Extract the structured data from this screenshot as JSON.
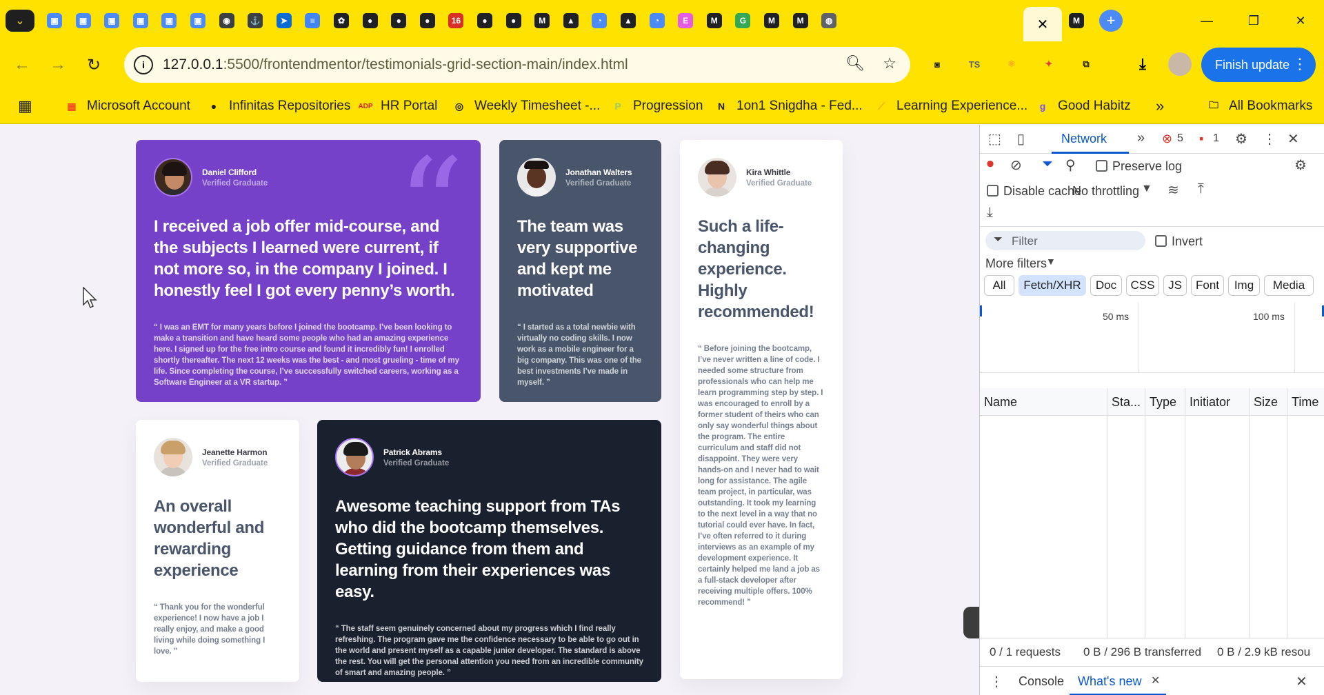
{
  "tabs": {
    "items": [
      {
        "icon": "monitor-favicon-icon",
        "color": "#4c8bf5",
        "glyph": "▣"
      },
      {
        "icon": "monitor-favicon-icon",
        "color": "#4c8bf5",
        "glyph": "▣"
      },
      {
        "icon": "monitor-favicon-icon",
        "color": "#4c8bf5",
        "glyph": "▣"
      },
      {
        "icon": "monitor-favicon-icon",
        "color": "#4c8bf5",
        "glyph": "▣"
      },
      {
        "icon": "monitor-favicon-icon",
        "color": "#4c8bf5",
        "glyph": "▣"
      },
      {
        "icon": "monitor-favicon-icon",
        "color": "#4c8bf5",
        "glyph": "▣"
      },
      {
        "icon": "compass-favicon-icon",
        "color": "#3c4043",
        "glyph": "◉"
      },
      {
        "icon": "anchor-favicon-icon",
        "color": "#3c4043",
        "glyph": "⚓"
      },
      {
        "icon": "azure-favicon-icon",
        "color": "#0a6cd4",
        "glyph": "➤"
      },
      {
        "icon": "docs-favicon-icon",
        "color": "#4285f4",
        "glyph": "≡"
      },
      {
        "icon": "openai-favicon-icon",
        "color": "#202124",
        "glyph": "✿"
      },
      {
        "icon": "github-favicon-icon",
        "color": "#202124",
        "glyph": "●"
      },
      {
        "icon": "github-favicon-icon",
        "color": "#202124",
        "glyph": "●"
      },
      {
        "icon": "github-favicon-icon",
        "color": "#202124",
        "glyph": "●"
      },
      {
        "icon": "calendar-favicon-icon",
        "color": "#d93025",
        "glyph": "16"
      },
      {
        "icon": "github-favicon-icon",
        "color": "#202124",
        "glyph": "●"
      },
      {
        "icon": "github-favicon-icon",
        "color": "#202124",
        "glyph": "●"
      },
      {
        "icon": "medium-favicon-icon",
        "color": "#202124",
        "glyph": "M"
      },
      {
        "icon": "triangle-favicon-icon",
        "color": "#202124",
        "glyph": "▲"
      },
      {
        "icon": "chat-favicon-icon",
        "color": "#4c8bf5",
        "glyph": "◔"
      },
      {
        "icon": "triangle-favicon-icon",
        "color": "#202124",
        "glyph": "▲"
      },
      {
        "icon": "chat-favicon-icon",
        "color": "#4c8bf5",
        "glyph": "◔"
      },
      {
        "icon": "elementor-favicon-icon",
        "color": "#e55ce0",
        "glyph": "E"
      },
      {
        "icon": "frontendmentor-favicon-icon",
        "color": "#202124",
        "glyph": "M"
      },
      {
        "icon": "google-favicon-icon",
        "color": "#34a853",
        "glyph": "G"
      },
      {
        "icon": "frontendmentor-favicon-icon",
        "color": "#202124",
        "glyph": "M"
      },
      {
        "icon": "frontendmentor-favicon-icon",
        "color": "#202124",
        "glyph": "M"
      },
      {
        "icon": "globe-favicon-icon",
        "color": "#5f6368",
        "glyph": "◍"
      }
    ],
    "active_close": "✕",
    "after_active": {
      "icon": "frontendmentor-favicon-icon",
      "color": "#202124",
      "glyph": "M"
    },
    "new_tab": "+"
  },
  "toolbar": {
    "url_host": "127.0.0.1",
    "url_path": ":5500/frontendmentor/testimonials-grid-section-main/index.html",
    "finish_update": "Finish update",
    "extensions": [
      {
        "icon": "profile-card-extension-icon",
        "glyph": "◙"
      },
      {
        "icon": "typescript-extension-icon",
        "glyph": "TS"
      },
      {
        "icon": "react-extension-icon",
        "glyph": "⚛"
      },
      {
        "icon": "colorful-extension-icon",
        "glyph": "✦"
      },
      {
        "icon": "puzzle-extensions-icon",
        "glyph": "⧉"
      }
    ]
  },
  "bookmarks": {
    "items": [
      {
        "label": "Microsoft Account",
        "icon": "microsoft-icon",
        "glyph": "▦",
        "color": "#f25022"
      },
      {
        "label": "Infinitas Repositories",
        "icon": "github-icon",
        "glyph": "●",
        "color": "#202124"
      },
      {
        "label": "HR Portal",
        "icon": "adp-icon",
        "glyph": "ADP",
        "color": "#d0271d"
      },
      {
        "label": "Weekly Timesheet -...",
        "icon": "timesheet-icon",
        "glyph": "◎",
        "color": "#202124"
      },
      {
        "label": "Progression",
        "icon": "progression-icon",
        "glyph": "P",
        "color": "#9ccc65"
      },
      {
        "label": "1on1 Snigdha - Fed...",
        "icon": "notion-icon",
        "glyph": "N",
        "color": "#202124"
      },
      {
        "label": "Learning Experience...",
        "icon": "learning-icon",
        "glyph": "⟋",
        "color": "#f9a825"
      },
      {
        "label": "Good Habitz",
        "icon": "goodhabitz-icon",
        "glyph": "g",
        "color": "#7c4dff"
      }
    ],
    "more": "»",
    "all_bookmarks": "All Bookmarks"
  },
  "testimonials": [
    {
      "name": "Daniel Clifford",
      "sub": "Verified Graduate",
      "headline": "I received a job offer mid-course, and the subjects I learned were current, if not more so, in the company I joined. I honestly feel I got every penny’s worth.",
      "quote": "“ I was an EMT for many years before I joined the bootcamp. I’ve been looking to make a transition and have heard some people who had an amazing experience here. I signed up for the free intro course and found it incredibly fun! I enrolled shortly thereafter. The next 12 weeks was the best - and most grueling - time of my life. Since completing the course, I’ve successfully switched careers, working as a Software Engineer at a VR startup. ”",
      "bg": "#7541c8"
    },
    {
      "name": "Jonathan Walters",
      "sub": "Verified Graduate",
      "headline": "The team was very supportive and kept me motivated",
      "quote": "“ I started as a total newbie with virtually no coding skills. I now work as a mobile engineer for a big company. This was one of the best investments I’ve made in myself. ”",
      "bg": "#48556a"
    },
    {
      "name": "Kira Whittle",
      "sub": "Verified Graduate",
      "headline": "Such a life-changing experience. Highly recommended!",
      "quote": "“ Before joining the bootcamp, I’ve never written a line of code. I needed some structure from professionals who can help me learn programming step by step. I was encouraged to enroll by a former student of theirs who can only say wonderful things about the program. The entire curriculum and staff did not disappoint. They were very hands-on and I never had to wait long for assistance. The agile team project, in particular, was outstanding. It took my learning to the next level in a way that no tutorial could ever have. In fact, I’ve often referred to it during interviews as an example of my development experience. It certainly helped me land a job as a full-stack developer after receiving multiple offers. 100% recommend! ”",
      "bg": "#ffffff"
    },
    {
      "name": "Jeanette Harmon",
      "sub": "Verified Graduate",
      "headline": "An overall wonderful and rewarding experience",
      "quote": "“ Thank you for the wonderful experience! I now have a job I really enjoy, and make a good living while doing something I love. ”",
      "bg": "#ffffff"
    },
    {
      "name": "Patrick Abrams",
      "sub": "Verified Graduate",
      "headline": "Awesome teaching support from TAs who did the bootcamp themselves. Getting guidance from them and learning from their experiences was easy.",
      "quote": "“ The staff seem genuinely concerned about my progress which I find really refreshing. The program gave me the confidence necessary to be able to go out in the world and present myself as a capable junior developer. The standard is above the rest. You will get the personal attention you need from an incredible community of smart and amazing people. ”",
      "bg": "#19212e"
    }
  ],
  "devtools": {
    "tab_network": "Network",
    "errors": "5",
    "warnings": "1",
    "preserve_log": "Preserve log",
    "disable_cache": "Disable cache",
    "throttling": "No throttling",
    "filter_placeholder": "Filter",
    "invert": "Invert",
    "more_filters": "More filters",
    "chips": [
      "All",
      "Fetch/XHR",
      "Doc",
      "CSS",
      "JS",
      "Font",
      "Img",
      "Media"
    ],
    "timeline": [
      "50 ms",
      "100 ms"
    ],
    "columns": [
      "Name",
      "Sta...",
      "Type",
      "Initiator",
      "Size",
      "Time"
    ],
    "status": {
      "requests": "0 / 1 requests",
      "transferred": "0 B / 296 B transferred",
      "resources": "0 B / 2.9 kB resou"
    },
    "drawer": {
      "console": "Console",
      "whats_new": "What's new"
    }
  }
}
